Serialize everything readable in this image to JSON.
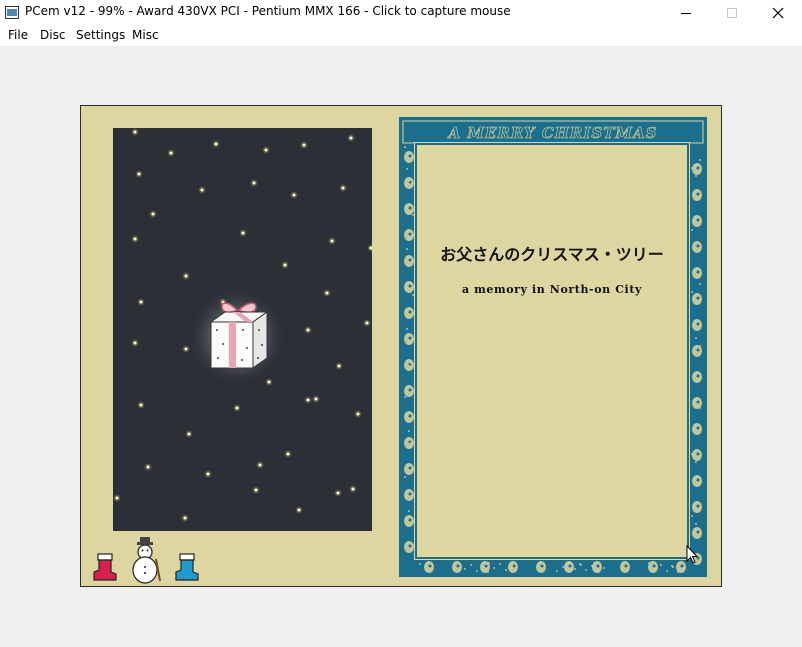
{
  "window": {
    "title": "PCem v12 - 99% - Award 430VX PCI - Pentium MMX 166 - Click to capture mouse",
    "controls": {
      "minimize": "minimize-icon",
      "maximize": "maximize-icon",
      "close": "close-icon"
    }
  },
  "menu": {
    "items": [
      "File",
      "Disc",
      "Settings",
      "Misc"
    ]
  },
  "screen": {
    "card": {
      "header": "A MERRY CHRISTMAS",
      "title": "お父さんのクリスマス・ツリー",
      "subtitle": "a memory in North-on City"
    },
    "bottom_icons": [
      "red-boot-icon",
      "snowman-icon",
      "blue-boot-icon"
    ],
    "center_icon": "gift-box-icon"
  },
  "colors": {
    "screen_bg": "#ded6a0",
    "night_sky": "#2c2f36",
    "star": "#f4ef8a",
    "card_frame": "#1b6f8c",
    "boot_red": "#d8204f",
    "boot_blue": "#1f9bd0"
  }
}
